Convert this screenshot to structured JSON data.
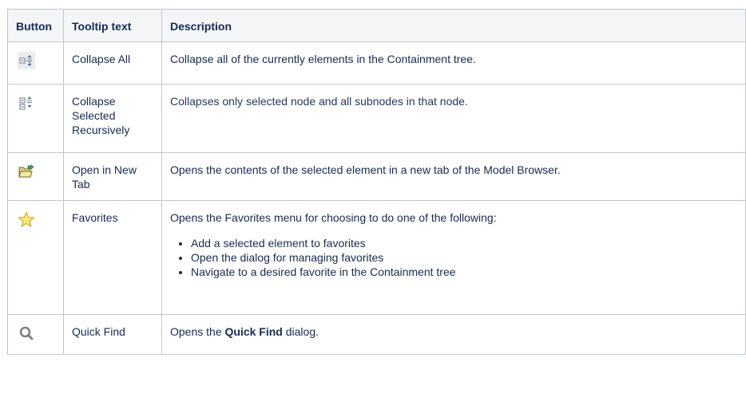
{
  "table": {
    "headers": {
      "button": "Button",
      "tooltip": "Tooltip text",
      "description": "Description"
    },
    "rows": [
      {
        "icon": "collapse-all-icon",
        "tooltip": "Collapse All",
        "description": "Collapse all of the currently elements in the Containment tree."
      },
      {
        "icon": "collapse-selected-recursively-icon",
        "tooltip": "Collapse Selected Recursively",
        "description": "Collapses only selected node and all subnodes in that node."
      },
      {
        "icon": "open-in-new-tab-icon",
        "tooltip": "Open in New Tab",
        "description": "Opens the contents of the selected element in a new tab of the Model Browser."
      },
      {
        "icon": "favorites-star-icon",
        "tooltip": "Favorites",
        "description": "Opens the Favorites menu for choosing to do one of the following:",
        "list": [
          "Add a selected element to favorites",
          "Open the dialog for managing favorites",
          "Navigate to a desired favorite in the Containment tree"
        ]
      },
      {
        "icon": "quick-find-magnifier-icon",
        "tooltip": "Quick Find",
        "description_prefix": "Opens the ",
        "description_bold": "Quick Find",
        "description_suffix": " dialog."
      }
    ]
  }
}
